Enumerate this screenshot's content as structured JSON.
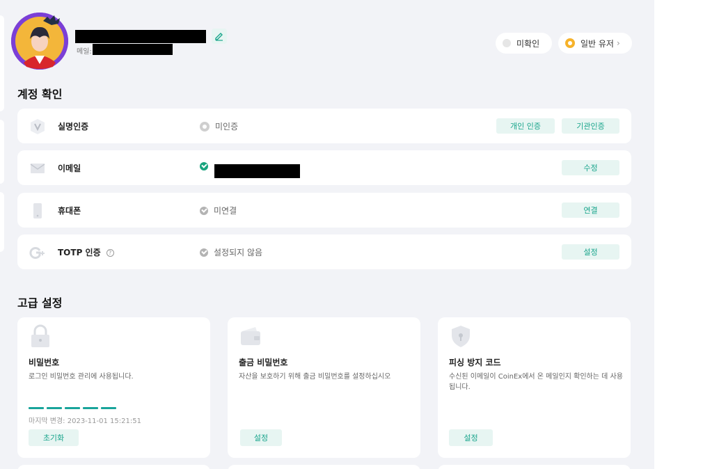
{
  "header": {
    "email_label": "메일:",
    "verify_badge": "미확인",
    "user_level": "일반 유저"
  },
  "account_section": {
    "title": "계정 확인",
    "rows": [
      {
        "label": "실명인증",
        "status": "미인증",
        "buttons": [
          "개인 인증",
          "기관인증"
        ]
      },
      {
        "label": "이메일",
        "status": "",
        "buttons": [
          "수정"
        ]
      },
      {
        "label": "휴대폰",
        "status": "미연결",
        "buttons": [
          "연결"
        ]
      },
      {
        "label": "TOTP 인증",
        "status": "설정되지 않음",
        "buttons": [
          "설정"
        ]
      }
    ]
  },
  "advanced_section": {
    "title": "고급 설정",
    "cards": [
      {
        "title": "비밀번호",
        "desc": "로그인 비밀번호 관리에 사용됩니다.",
        "last_changed": "마지막 변경: 2023-11-01 15:21:51",
        "button": "초기화"
      },
      {
        "title": "출금 비밀번호",
        "desc": "자산을 보호하기 위해 출금 비밀번호를 설정하십시오",
        "button": "설정"
      },
      {
        "title": "피싱 방지 코드",
        "desc": "수신된 이메일이 CoinEx에서 온 메일인지 확인하는 데 사용됩니다.",
        "button": "설정"
      }
    ]
  },
  "colors": {
    "accent": "#1aa58c",
    "accent_bg": "#e7f5f2",
    "page_bg": "#f2f3f7",
    "avatar_ring": "#7b3fd6"
  },
  "icons": {
    "realname": "v-badge-icon",
    "email": "envelope-icon",
    "phone": "phone-icon",
    "totp": "google-auth-icon",
    "password": "lock-icon",
    "withdraw": "wallet-icon",
    "antiphishing": "shield-icon"
  }
}
